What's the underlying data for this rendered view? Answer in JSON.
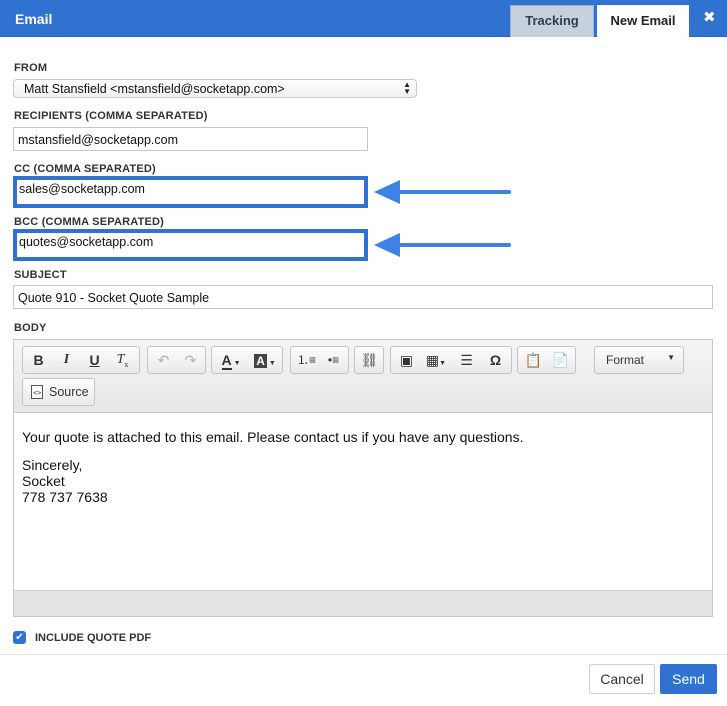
{
  "window": {
    "title": "Email"
  },
  "tabs": [
    {
      "label": "Tracking",
      "active": false
    },
    {
      "label": "New Email",
      "active": true
    }
  ],
  "close_icon": "close-icon",
  "from": {
    "label": "FROM",
    "selected": "Matt Stansfield <mstansfield@socketapp.com>"
  },
  "recipients": {
    "label": "RECIPIENTS (COMMA SEPARATED)",
    "value": "mstansfield@socketapp.com"
  },
  "cc": {
    "label": "CC (COMMA SEPARATED)",
    "value": "sales@socketapp.com"
  },
  "bcc": {
    "label": "BCC (COMMA SEPARATED)",
    "value": "quotes@socketapp.com"
  },
  "subject": {
    "label": "SUBJECT",
    "value": "Quote 910 - Socket Quote Sample"
  },
  "body": {
    "label": "BODY",
    "toolbar": {
      "icons": [
        "bold-icon",
        "italic-icon",
        "underline-icon",
        "remove-format-icon",
        "undo-icon",
        "redo-icon",
        "text-color-icon",
        "background-color-icon",
        "numbered-list-icon",
        "bulleted-list-icon",
        "link-icon",
        "image-icon",
        "table-icon",
        "horizontal-line-icon",
        "special-character-icon",
        "paste-word-icon",
        "paste-text-icon"
      ],
      "format_label": "Format",
      "source_label": "Source"
    },
    "lines": [
      "Your quote is attached to this email. Please contact us if you have any questions.",
      "",
      "Sincerely,",
      "Socket",
      "778 737 7638"
    ]
  },
  "include_pdf": {
    "label": "INCLUDE QUOTE PDF",
    "checked": true
  },
  "actions": {
    "cancel": "Cancel",
    "send": "Send"
  },
  "colors": {
    "accent": "#2f72cf",
    "tab_inactive": "#c7d1dd"
  }
}
